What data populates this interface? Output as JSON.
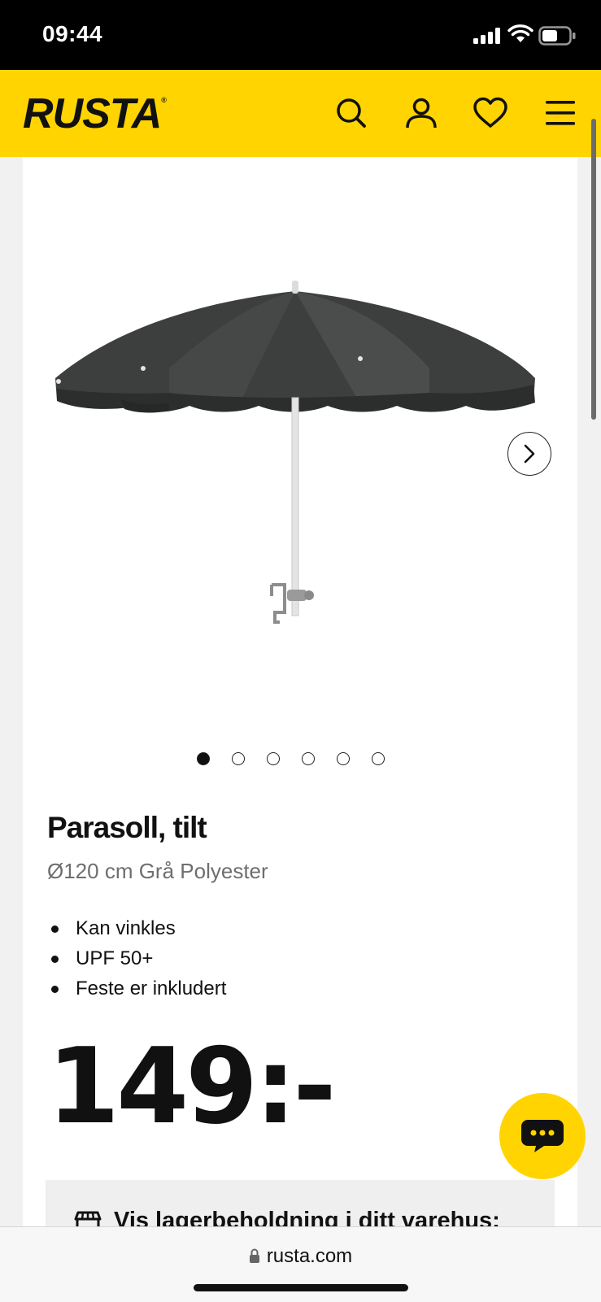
{
  "status_bar": {
    "time": "09:44"
  },
  "header": {
    "logo": "RUSTA",
    "logo_mark": "®"
  },
  "product": {
    "title": "Parasoll, tilt",
    "subtitle": "Ø120 cm Grå Polyester",
    "features": [
      "Kan vinkles",
      "UPF 50+",
      "Feste er inkludert"
    ],
    "price": "149:-",
    "image_count": 6,
    "active_image": 1
  },
  "stock": {
    "label": "Vis lagerbeholdning i ditt varehus:"
  },
  "browser": {
    "url": "rusta.com"
  },
  "colors": {
    "brand_yellow": "#ffd400",
    "text": "#111111",
    "muted": "#6e6e6e"
  }
}
